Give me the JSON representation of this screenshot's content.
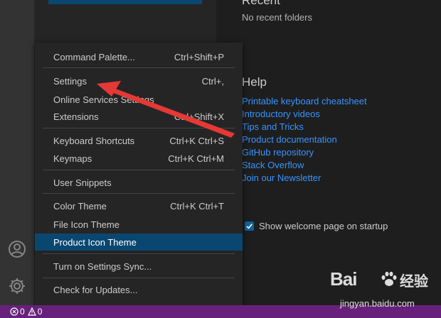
{
  "welcome": {
    "recent_heading": "Recent",
    "recent_empty": "No recent folders",
    "help_heading": "Help",
    "help_links": [
      "Printable keyboard cheatsheet",
      "Introductory videos",
      "Tips and Tricks",
      "Product documentation",
      "GitHub repository",
      "Stack Overflow",
      "Join our Newsletter"
    ],
    "show_on_startup_label": "Show welcome page on startup",
    "show_on_startup_checked": true,
    "link_color": "#3794ff"
  },
  "menu": {
    "items": [
      {
        "label": "Command Palette...",
        "shortcut": "Ctrl+Shift+P"
      },
      {
        "label": "Settings",
        "shortcut": "Ctrl+,"
      },
      {
        "label": "Online Services Settings",
        "shortcut": ""
      },
      {
        "label": "Extensions",
        "shortcut": "Ctrl+Shift+X"
      },
      {
        "label": "Keyboard Shortcuts",
        "shortcut": "Ctrl+K Ctrl+S"
      },
      {
        "label": "Keymaps",
        "shortcut": "Ctrl+K Ctrl+M"
      },
      {
        "label": "User Snippets",
        "shortcut": ""
      },
      {
        "label": "Color Theme",
        "shortcut": "Ctrl+K Ctrl+T"
      },
      {
        "label": "File Icon Theme",
        "shortcut": ""
      },
      {
        "label": "Product Icon Theme",
        "shortcut": ""
      },
      {
        "label": "Turn on Settings Sync...",
        "shortcut": ""
      },
      {
        "label": "Check for Updates...",
        "shortcut": ""
      }
    ],
    "active_item": "Product Icon Theme",
    "highlight_color": "#094771"
  },
  "activity_bar": {
    "icons": [
      "accounts-icon",
      "manage-gear-icon"
    ]
  },
  "status_bar": {
    "errors": "0",
    "warnings": "0",
    "background": "#68217a"
  },
  "annotation": {
    "arrow_color": "#e53935"
  },
  "watermark": {
    "brand": "Bai",
    "brand_suffix": "经验",
    "url": "jingyan.baidu.com"
  }
}
